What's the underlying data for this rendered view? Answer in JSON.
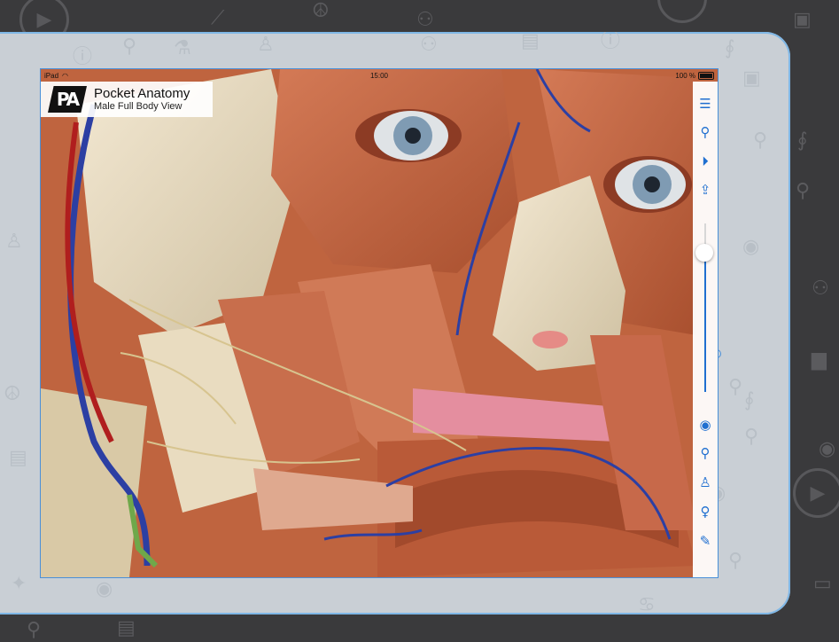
{
  "status_bar": {
    "device": "iPad",
    "time": "15:00",
    "battery": "100 %"
  },
  "logo": {
    "mark": "PA",
    "title": "Pocket Anatomy",
    "subtitle": "Male Full Body View"
  },
  "toolbar": {
    "top_items": [
      "menu-icon",
      "search-icon",
      "play-icon",
      "share-icon"
    ],
    "bottom_items": [
      "eye-icon",
      "pin-icon",
      "tshirt-icon",
      "female-icon",
      "pencil-icon"
    ],
    "slider_level": 0.18,
    "accent_color": "#1f6fd0"
  },
  "colors": {
    "background": "#3a3a3c",
    "frame": "#c9cfd5",
    "frame_border": "#4a90d9"
  }
}
